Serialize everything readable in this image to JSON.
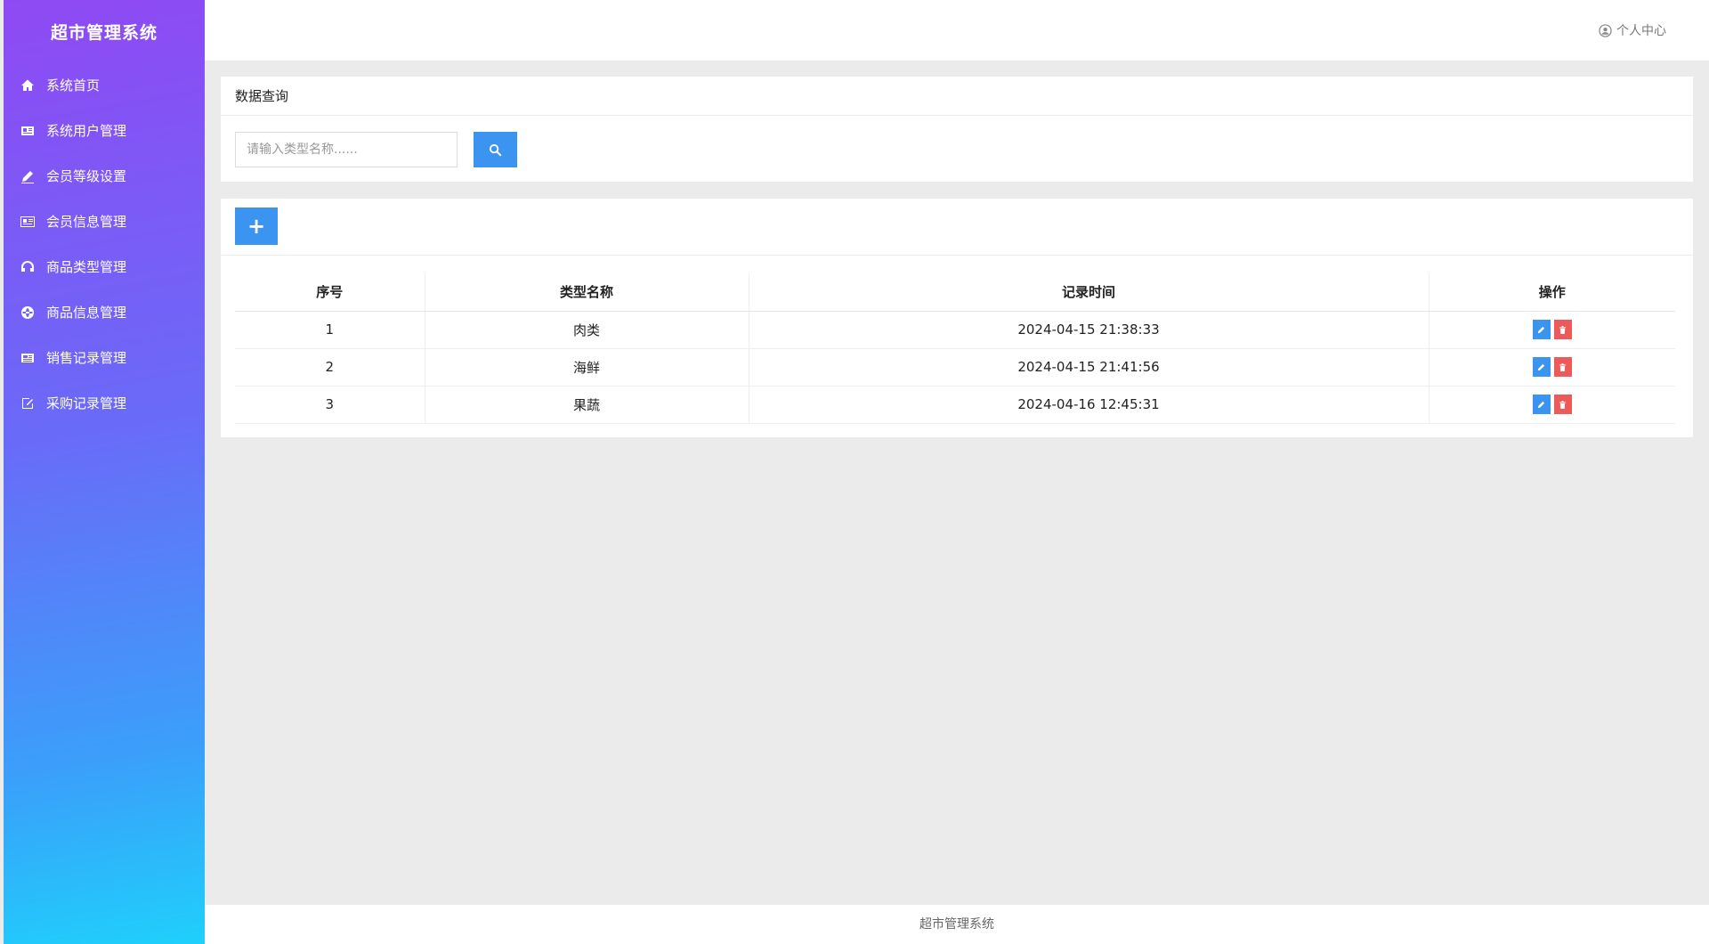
{
  "app": {
    "title": "超市管理系统"
  },
  "sidebar": {
    "items": [
      {
        "label": "系统首页",
        "icon": "home-icon"
      },
      {
        "label": "系统用户管理",
        "icon": "id-card-icon"
      },
      {
        "label": "会员等级设置",
        "icon": "pencil-icon"
      },
      {
        "label": "会员信息管理",
        "icon": "address-card-icon"
      },
      {
        "label": "商品类型管理",
        "icon": "headphones-icon"
      },
      {
        "label": "商品信息管理",
        "icon": "globe-icon"
      },
      {
        "label": "销售记录管理",
        "icon": "newspaper-icon"
      },
      {
        "label": "采购记录管理",
        "icon": "edit-icon"
      }
    ]
  },
  "header": {
    "user_center": "个人中心"
  },
  "query": {
    "title": "数据查询",
    "search_placeholder": "请输入类型名称......"
  },
  "table": {
    "columns": [
      "序号",
      "类型名称",
      "记录时间",
      "操作"
    ],
    "rows": [
      {
        "index": "1",
        "name": "肉类",
        "time": "2024-04-15 21:38:33"
      },
      {
        "index": "2",
        "name": "海鲜",
        "time": "2024-04-15 21:41:56"
      },
      {
        "index": "3",
        "name": "果蔬",
        "time": "2024-04-16 12:45:31"
      }
    ]
  },
  "footer": {
    "text": "超市管理系统"
  },
  "colors": {
    "primary": "#3b95f0",
    "danger": "#ec5a5a",
    "sidebar_top": "#8f49f3",
    "sidebar_bottom": "#1fd0fb"
  }
}
